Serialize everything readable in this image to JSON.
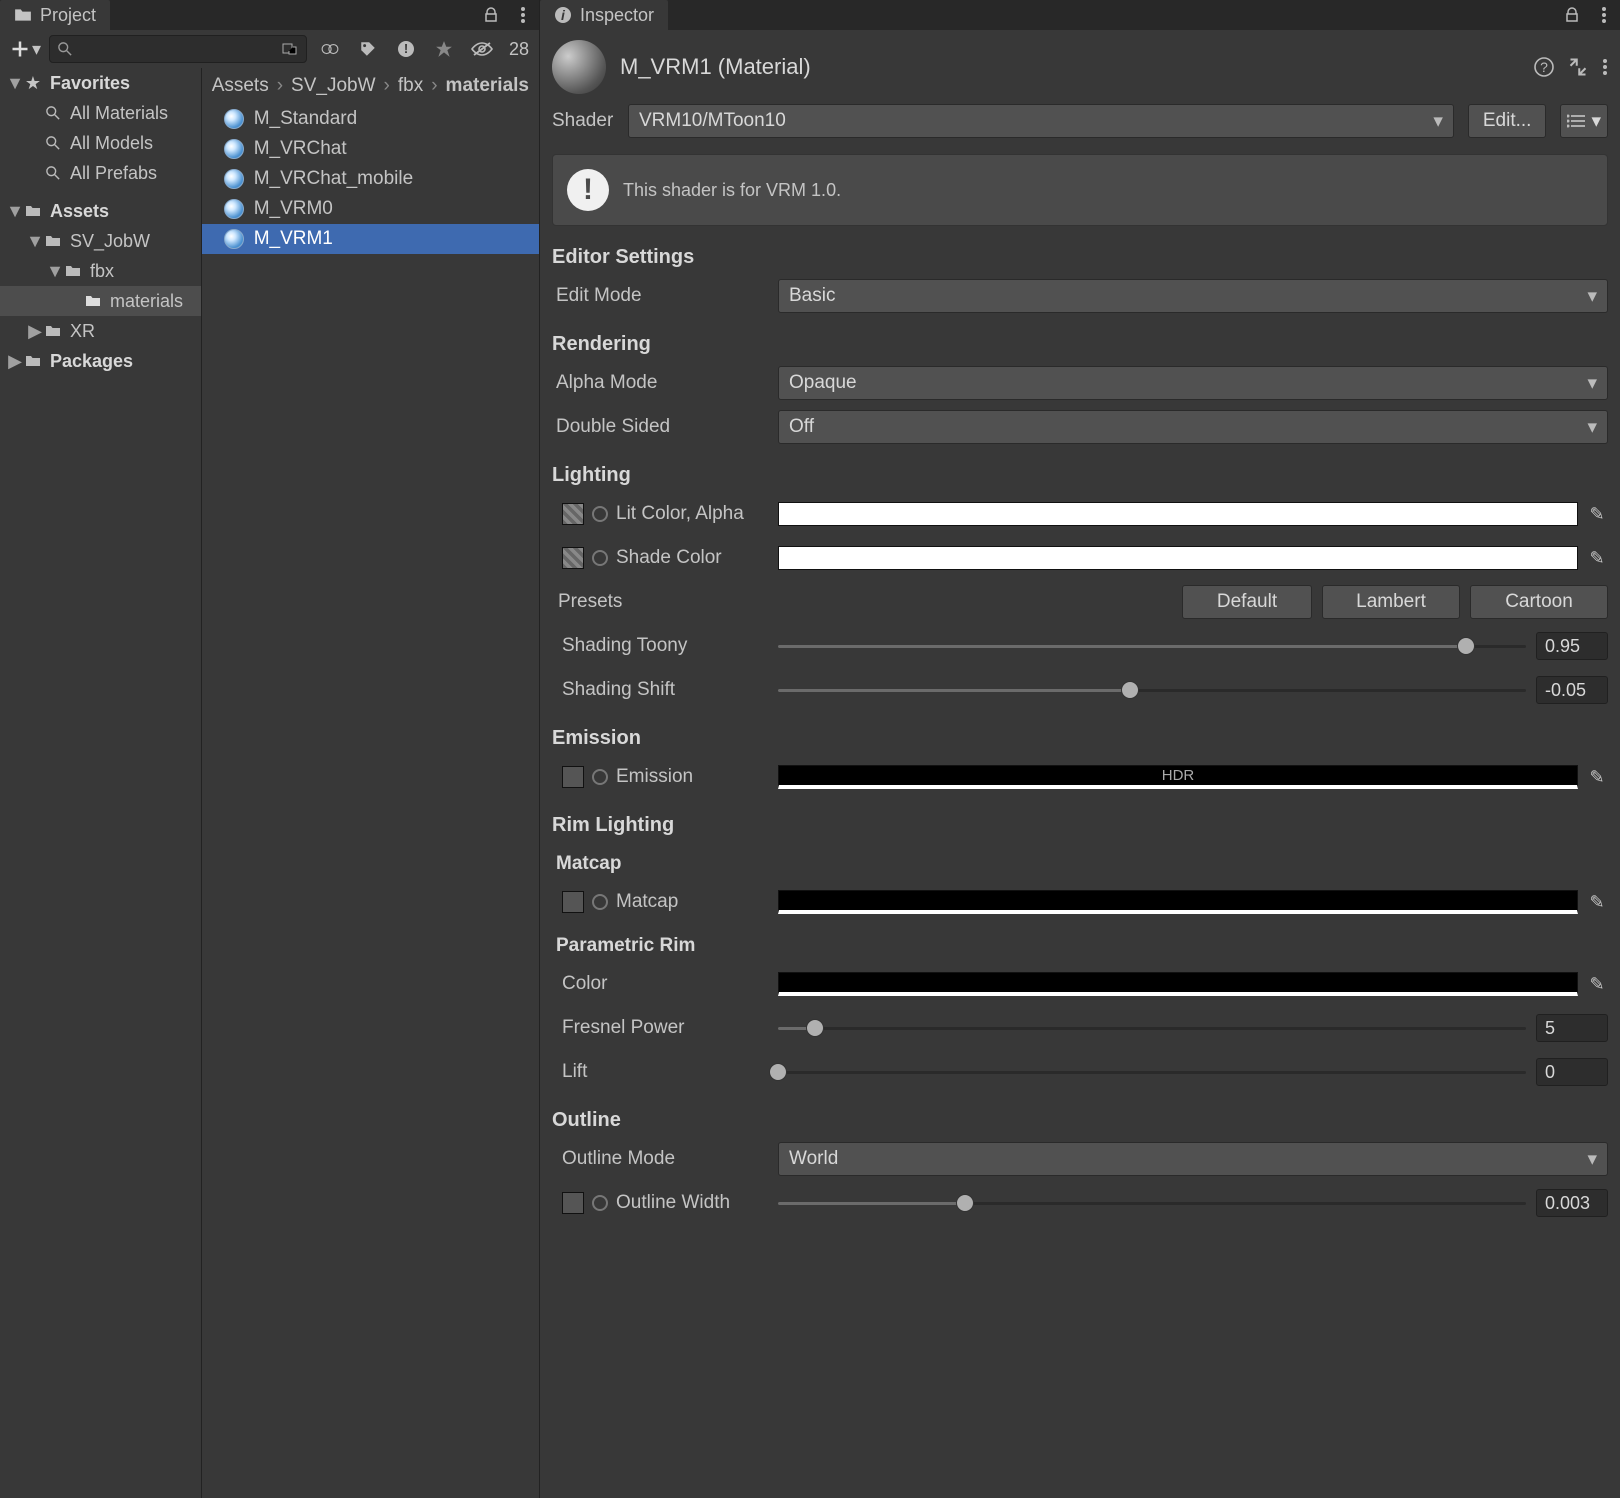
{
  "project": {
    "tab_label": "Project",
    "hidden_count": "28",
    "favorites": {
      "label": "Favorites",
      "items": [
        "All Materials",
        "All Models",
        "All Prefabs"
      ]
    },
    "assets": {
      "label": "Assets",
      "sv": "SV_JobW",
      "fbx": "fbx",
      "materials": "materials",
      "xr": "XR"
    },
    "packages": "Packages",
    "breadcrumb": [
      "Assets",
      "SV_JobW",
      "fbx",
      "materials"
    ],
    "asset_items": [
      "M_Standard",
      "M_VRChat",
      "M_VRChat_mobile",
      "M_VRM0",
      "M_VRM1"
    ]
  },
  "inspector": {
    "tab_label": "Inspector",
    "title": "M_VRM1 (Material)",
    "shader_label": "Shader",
    "shader_value": "VRM10/MToon10",
    "edit_btn": "Edit...",
    "notice": "This shader is for VRM 1.0.",
    "editor_settings": {
      "title": "Editor Settings",
      "edit_mode_label": "Edit Mode",
      "edit_mode_value": "Basic"
    },
    "rendering": {
      "title": "Rendering",
      "alpha_label": "Alpha Mode",
      "alpha_value": "Opaque",
      "double_label": "Double Sided",
      "double_value": "Off"
    },
    "lighting": {
      "title": "Lighting",
      "lit_label": "Lit Color, Alpha",
      "shade_label": "Shade Color",
      "presets_label": "Presets",
      "preset_default": "Default",
      "preset_lambert": "Lambert",
      "preset_cartoon": "Cartoon",
      "toony_label": "Shading Toony",
      "toony_value": "0.95",
      "shift_label": "Shading Shift",
      "shift_value": "-0.05"
    },
    "emission": {
      "title": "Emission",
      "label": "Emission",
      "hdr": "HDR"
    },
    "rim": {
      "title": "Rim Lighting",
      "matcap_title": "Matcap",
      "matcap_label": "Matcap",
      "param_title": "Parametric Rim",
      "color_label": "Color",
      "fresnel_label": "Fresnel Power",
      "fresnel_value": "5",
      "lift_label": "Lift",
      "lift_value": "0"
    },
    "outline": {
      "title": "Outline",
      "mode_label": "Outline Mode",
      "mode_value": "World",
      "width_label": "Outline Width",
      "width_value": "0.003"
    }
  }
}
